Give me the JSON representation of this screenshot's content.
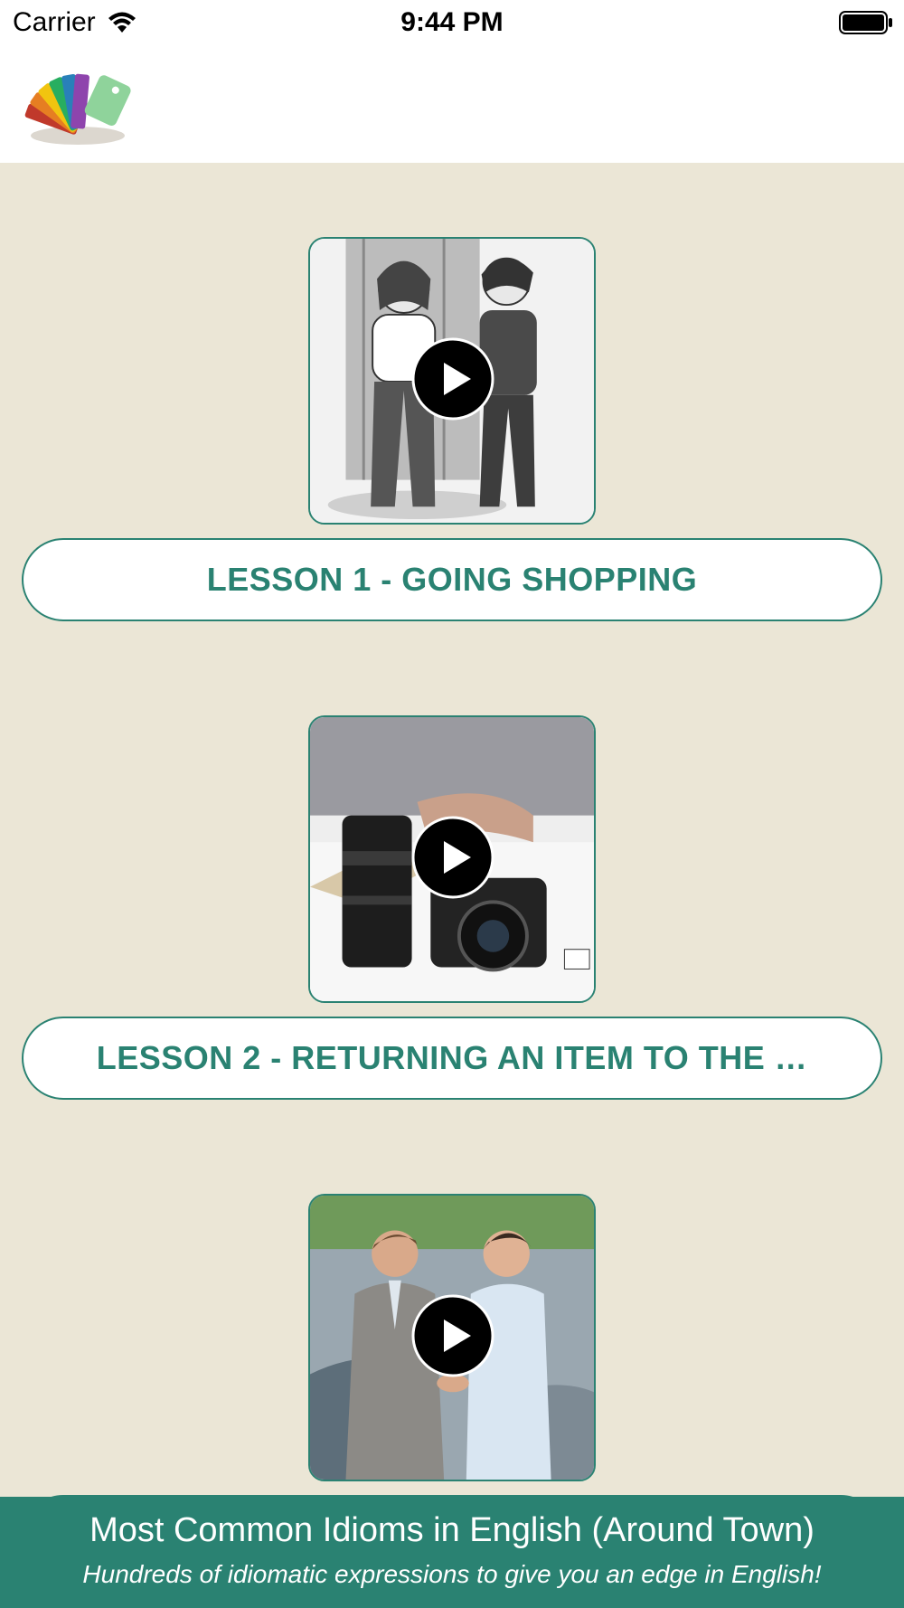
{
  "status_bar": {
    "carrier": "Carrier",
    "time": "9:44 PM",
    "icons": [
      "wifi-icon",
      "battery-icon"
    ]
  },
  "nav_bar": {
    "logo_icon": "flashcard-fan-logo"
  },
  "lessons": [
    {
      "label": "LESSON 1 - GOING SHOPPING",
      "thumbnail": "fitting-room-cartoon",
      "play_icon": "play-icon"
    },
    {
      "label": "LESSON 2 - RETURNING AN ITEM TO THE …",
      "thumbnail": "camera-and-lens",
      "play_icon": "play-icon"
    },
    {
      "label": "",
      "thumbnail": "car-dealer-handshake",
      "play_icon": "play-icon"
    }
  ],
  "footer": {
    "title": "Most Common Idioms in English (Around Town)",
    "subtitle": "Hundreds of idiomatic expressions to give you an edge in English!"
  },
  "colors": {
    "accent": "#2a8272",
    "background": "#ebe6d6",
    "bar": "#ffffff"
  }
}
